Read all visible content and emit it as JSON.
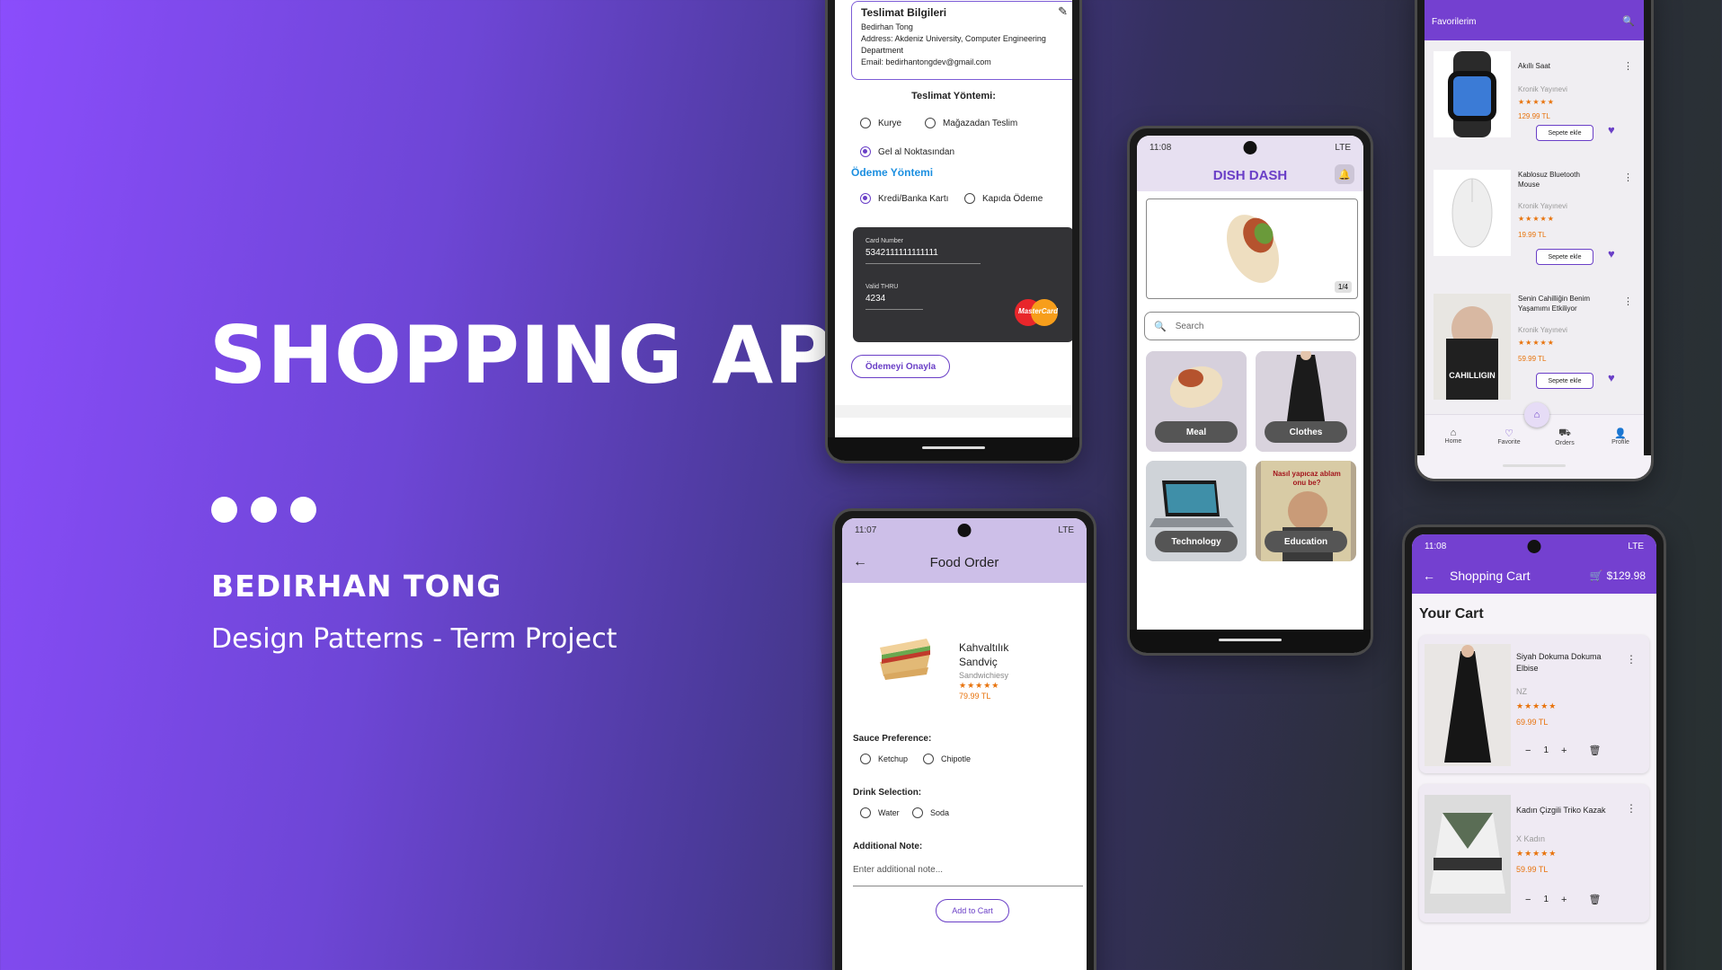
{
  "hero": {
    "title": "SHOPPING APP",
    "author": "BEDIRHAN TONG",
    "subtitle": "Design Patterns - Term Project"
  },
  "checkout": {
    "address_title": "Teslimat Bilgileri",
    "address_name": "Bedirhan Tong",
    "address_line": "Address: Akdeniz University, Computer Engineering Department",
    "address_email": "Email: bedirhantongdev@gmail.com",
    "delivery_heading": "Teslimat Yöntemi:",
    "delivery_options": [
      "Kurye",
      "Mağazadan Teslim",
      "Gel al Noktasından"
    ],
    "delivery_selected": "Gel al Noktasından",
    "payment_heading": "Ödeme Yöntemi",
    "payment_options": [
      "Kredi/Banka Kartı",
      "Kapıda Ödeme"
    ],
    "payment_selected": "Kredi/Banka Kartı",
    "card_number_label": "Card Number",
    "card_number": "5342111111111111",
    "valid_label": "Valid THRU",
    "valid_value": "4234",
    "card_brand": "MasterCard",
    "confirm_button": "Ödemeyi Onayla"
  },
  "food_order": {
    "time": "11:07",
    "network": "LTE",
    "title": "Food Order",
    "product_name": "Kahvaltılık Sandviç",
    "product_brand": "Sandwichiesy",
    "stars": "★★★★★",
    "price": "79.99 TL",
    "sauce_label": "Sauce Preference:",
    "sauce_options": [
      "Ketchup",
      "Chipotle"
    ],
    "drink_label": "Drink Selection:",
    "drink_options": [
      "Water",
      "Soda"
    ],
    "note_label": "Additional Note:",
    "note_placeholder": "Enter additional note...",
    "add_button": "Add to Cart"
  },
  "dish_dash": {
    "time": "11:08",
    "network": "LTE",
    "title": "DISH DASH",
    "banner_counter": "1/4",
    "search_placeholder": "Search",
    "categories": [
      "Meal",
      "Clothes",
      "Technology",
      "Education"
    ],
    "book_cover_text": "Nasıl yapıcaz ablam onu be?"
  },
  "favorites": {
    "title": "Favorilerim",
    "items": [
      {
        "name": "Akıllı Saat",
        "brand": "Kronik Yayınevi",
        "stars": "★★★★★",
        "price": "129.99 TL",
        "button": "Sepete ekle"
      },
      {
        "name": "Kablosuz Bluetooth Mouse",
        "brand": "Kronik Yayınevi",
        "stars": "★★★★★",
        "price": "19.99 TL",
        "button": "Sepete ekle"
      },
      {
        "name": "Senin Cahilliğin Benim Yaşamımı Etkiliyor",
        "brand": "Kronik Yayınevi",
        "stars": "★★★★★",
        "price": "59.99 TL",
        "button": "Sepete ekle"
      }
    ],
    "book_title": "CAHILLIGIN",
    "nav": [
      "Home",
      "Favorite",
      "Orders",
      "Profile"
    ]
  },
  "cart": {
    "time": "11:08",
    "network": "LTE",
    "title": "Shopping Cart",
    "total": "$129.98",
    "heading": "Your Cart",
    "items": [
      {
        "name": "Siyah Dokuma Dokuma Elbise",
        "brand": "NZ",
        "stars": "★★★★★",
        "price": "69.99 TL",
        "qty": "1"
      },
      {
        "name": "Kadın Çizgili Triko Kazak",
        "brand": "X Kadın",
        "stars": "★★★★★",
        "price": "59.99 TL",
        "qty": "1"
      }
    ]
  },
  "colors": {
    "accent": "#6a3fc7",
    "price": "#e8730c",
    "link_blue": "#1c8fe0",
    "app_header": "#7440d0"
  }
}
